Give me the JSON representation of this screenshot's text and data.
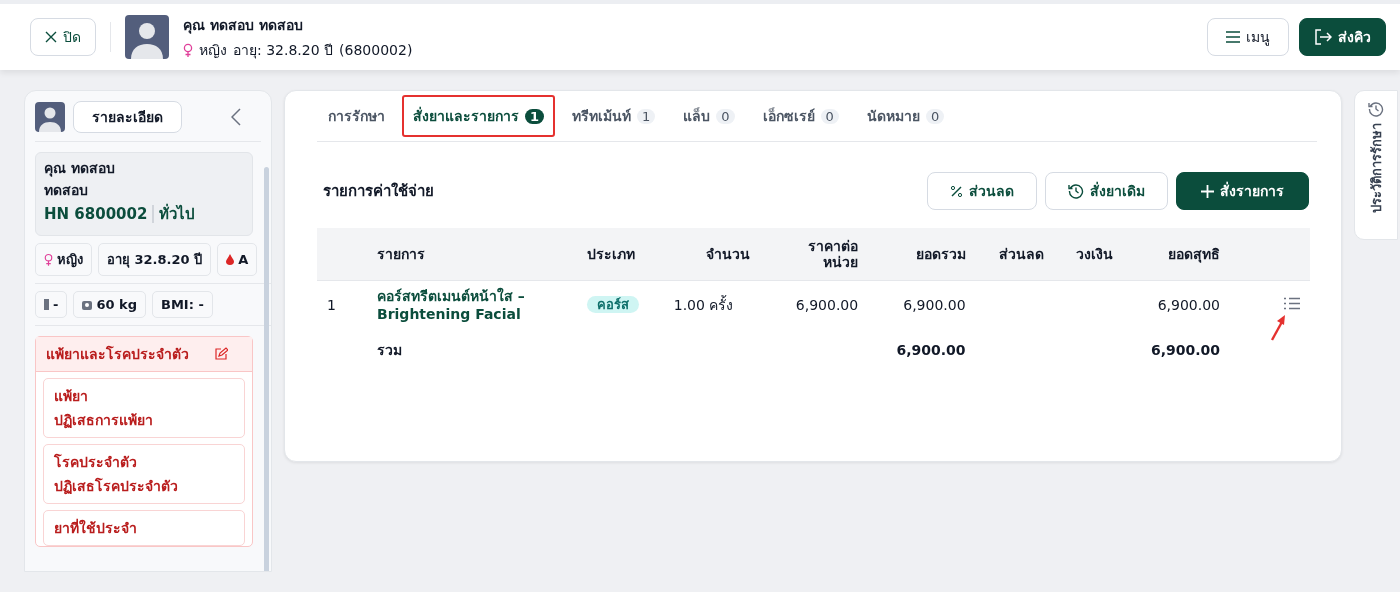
{
  "header": {
    "close_label": "ปิด",
    "patient_name": "คุณ ทดสอบ ทดสอบ",
    "gender": "หญิง",
    "age": "อายุ: 32.8.20 ปี",
    "id": "(6800002)",
    "menu_label": "เมนู",
    "send_label": "ส่งคิว"
  },
  "sidebar": {
    "details_button": "รายละเอียด",
    "name_lines": [
      "คุณ ทดสอบ",
      "ทดสอบ"
    ],
    "hn": "HN 6800002",
    "category": "ทั่วไป",
    "chips": [
      {
        "kind": "gender",
        "text": "หญิง"
      },
      {
        "kind": "plain",
        "text": "อายุ 32.8.20 ปี"
      },
      {
        "kind": "blood",
        "text": "A"
      }
    ],
    "vitals": [
      {
        "kind": "height",
        "text": "-"
      },
      {
        "kind": "weight",
        "text": "60 kg"
      },
      {
        "kind": "plain",
        "text": "BMI: -"
      }
    ],
    "allergy_title": "แพ้ยาและโรคประจำตัว",
    "allergy_cards": [
      {
        "title": "แพ้ยา",
        "value": "ปฏิเสธการแพ้ยา"
      },
      {
        "title": "โรคประจำตัว",
        "value": "ปฏิเสธโรคประจำตัว"
      },
      {
        "title": "ยาที่ใช้ประจำ"
      }
    ]
  },
  "tabs": [
    {
      "label": "การรักษา",
      "selected": false,
      "highlighted": false
    },
    {
      "label": "สั่งยาและรายการ",
      "count": "1",
      "selected": true,
      "highlighted": true
    },
    {
      "label": "ทรีทเม้นท์",
      "count": "1",
      "selected": false,
      "highlighted": false
    },
    {
      "label": "แล็บ",
      "count": "0",
      "selected": false,
      "highlighted": false
    },
    {
      "label": "เอ็กซเรย์",
      "count": "0",
      "selected": false,
      "highlighted": false
    },
    {
      "label": "นัดหมาย",
      "count": "0",
      "selected": false,
      "highlighted": false
    }
  ],
  "section_title": "รายการค่าใช้จ่าย",
  "actions": [
    {
      "kind": "discount",
      "label": "ส่วนลด"
    },
    {
      "kind": "history",
      "label": "สั่งยาเดิม"
    },
    {
      "kind": "add",
      "label": "สั่งรายการ"
    }
  ],
  "table": {
    "columns": [
      "รายการ",
      "ประเภท",
      "จำนวน",
      "ราคาต่อหน่วย",
      "ยอดรวม",
      "ส่วนลด",
      "วงเงิน",
      "ยอดสุทธิ"
    ],
    "rows": [
      {
        "no": "1",
        "name": "คอร์สทรีตเมนต์หน้าใส – Brightening Facial",
        "type": "คอร์ส",
        "qty": "1.00 ครั้ง",
        "unit_price": "6,900.00",
        "total": "6,900.00",
        "discount": "",
        "limit": "",
        "net": "6,900.00",
        "pointer": true
      }
    ],
    "footer": {
      "label": "รวม",
      "total": "6,900.00",
      "net": "6,900.00"
    }
  },
  "side_tab": "ประวัติการรักษา"
}
